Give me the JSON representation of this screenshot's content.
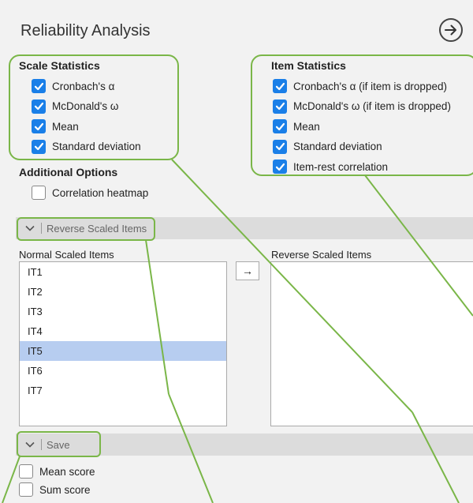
{
  "title": "Reliability Analysis",
  "icons": {
    "next": "arrow-right-circle-icon",
    "chevron": "chevron-down-icon",
    "move": "arrow-right-icon"
  },
  "colors": {
    "accent": "#1a7fe8",
    "highlight": "#7ab648",
    "selected_row": "#b7cdf0"
  },
  "scale_statistics": {
    "label": "Scale Statistics",
    "items": [
      {
        "label": "Cronbach's α",
        "checked": true
      },
      {
        "label": "McDonald's ω",
        "checked": true
      },
      {
        "label": "Mean",
        "checked": true
      },
      {
        "label": "Standard deviation",
        "checked": true
      }
    ]
  },
  "item_statistics": {
    "label": "Item Statistics",
    "items": [
      {
        "label": "Cronbach's α (if item is dropped)",
        "checked": true
      },
      {
        "label": "McDonald's ω (if item is dropped)",
        "checked": true
      },
      {
        "label": "Mean",
        "checked": true
      },
      {
        "label": "Standard deviation",
        "checked": true
      },
      {
        "label": "Item-rest correlation",
        "checked": true
      }
    ]
  },
  "additional_options": {
    "label": "Additional Options",
    "items": [
      {
        "label": "Correlation heatmap",
        "checked": false
      }
    ]
  },
  "reverse_section": {
    "label": "Reverse Scaled Items",
    "normal_label": "Normal Scaled Items",
    "reverse_label": "Reverse Scaled Items",
    "normal_items": [
      "IT1",
      "IT2",
      "IT3",
      "IT4",
      "IT5",
      "IT6",
      "IT7"
    ],
    "selected_item": "IT5",
    "reverse_items": [],
    "move_label": "→"
  },
  "save_section": {
    "label": "Save",
    "items": [
      {
        "label": "Mean score",
        "checked": false
      },
      {
        "label": "Sum score",
        "checked": false
      }
    ]
  }
}
